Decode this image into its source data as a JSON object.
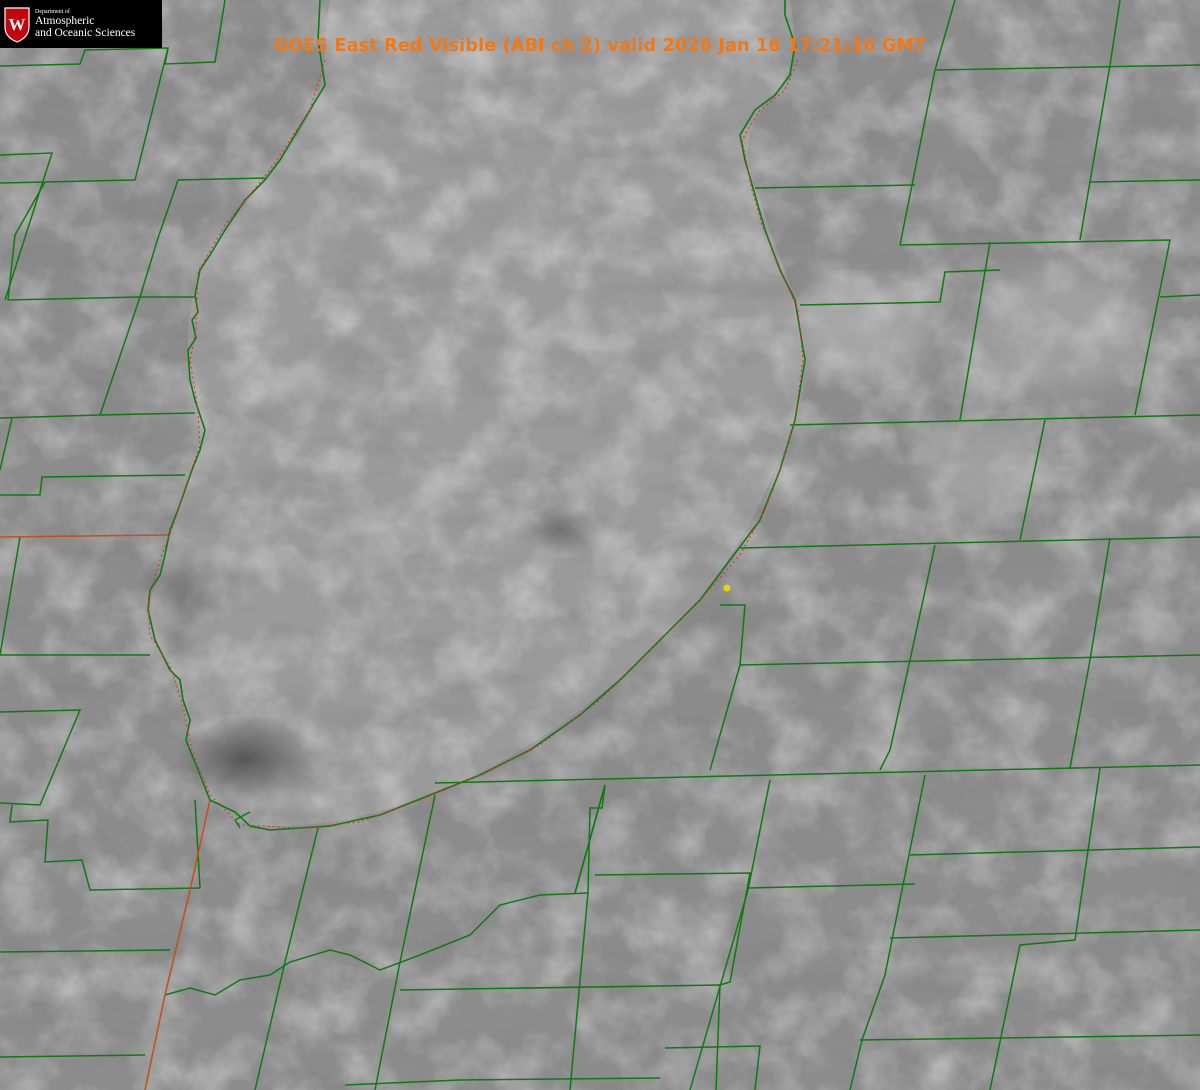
{
  "header": {
    "title": "GOES East Red Visible (ABI ch 2) valid 2026 Jan 16 17:21:16 GMT"
  },
  "logo": {
    "seal_letter": "W",
    "department_line": "Department of",
    "name_line_1": "Atmospheric",
    "name_line_2": "and Oceanic Sciences"
  },
  "colors": {
    "title": "#f07818",
    "county_lines": "#0e7a12",
    "state_line": "#c0531a",
    "lake_outline": "#e03030",
    "marker": "#e8d400"
  }
}
